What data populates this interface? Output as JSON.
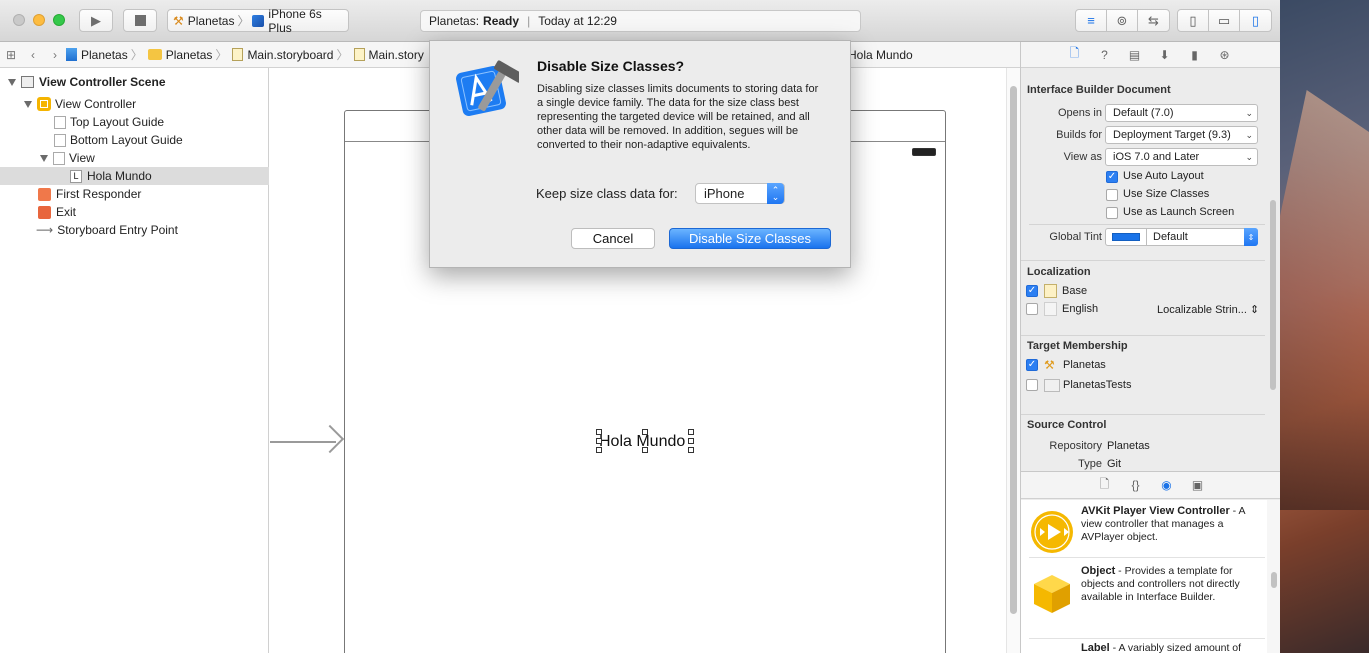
{
  "toolbar": {
    "scheme_target": "Planetas",
    "scheme_device": "iPhone 6s Plus",
    "status_project": "Planetas:",
    "status_state": "Ready",
    "status_time": "Today at 12:29"
  },
  "jumpbar": {
    "crumbs": [
      "Planetas",
      "Planetas",
      "Main.storyboard",
      "Main.story"
    ],
    "tail": "Hola Mundo"
  },
  "outline": {
    "scene": "View Controller Scene",
    "view_controller": "View Controller",
    "top_layout_guide": "Top Layout Guide",
    "bottom_layout_guide": "Bottom Layout Guide",
    "view": "View",
    "label_glyph": "L",
    "label_item": "Hola Mundo",
    "first_responder": "First Responder",
    "exit": "Exit",
    "entry_point": "Storyboard Entry Point"
  },
  "canvas": {
    "label_text": "Hola Mundo"
  },
  "dialog": {
    "title": "Disable Size Classes?",
    "body": "Disabling size classes limits documents to storing data for a single device family. The data for the size class best representing the targeted device will be retained, and all other data will be removed. In addition, segues will be converted to their non-adaptive equivalents.",
    "keep_label": "Keep size class data for:",
    "device_value": "iPhone",
    "cancel_label": "Cancel",
    "confirm_label": "Disable Size Classes"
  },
  "inspector": {
    "ib_doc_title": "Interface Builder Document",
    "opens_in_label": "Opens in",
    "opens_in_value": "Default (7.0)",
    "builds_for_label": "Builds for",
    "builds_for_value": "Deployment Target (9.3)",
    "view_as_label": "View as",
    "view_as_value": "iOS 7.0 and Later",
    "use_auto_layout": "Use Auto Layout",
    "use_size_classes": "Use Size Classes",
    "use_launch_screen": "Use as Launch Screen",
    "global_tint_label": "Global Tint",
    "global_tint_value": "Default",
    "localization_title": "Localization",
    "loc_base": "Base",
    "loc_english": "English",
    "loc_english_type": "Localizable Strin...",
    "target_title": "Target Membership",
    "target_planetas": "Planetas",
    "target_tests": "PlanetasTests",
    "source_title": "Source Control",
    "repository_label": "Repository",
    "repository_value": "Planetas",
    "type_label": "Type",
    "type_value": "Git"
  },
  "library": {
    "items": [
      {
        "name": "AVKit Player View Controller",
        "desc": " - A view controller that manages a AVPlayer object."
      },
      {
        "name": "Object",
        "desc": " - Provides a template for objects and controllers not directly available in Interface Builder."
      },
      {
        "name": "Label",
        "desc": " - A variably sized amount of"
      }
    ]
  },
  "colors": {
    "accent": "#1a73e8",
    "checkbox_on": "#2c7ff2"
  }
}
